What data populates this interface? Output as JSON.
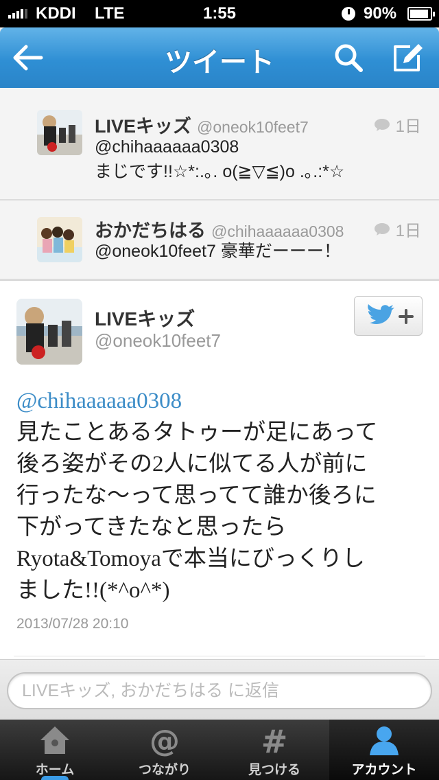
{
  "status_bar": {
    "carrier": "KDDI",
    "network": "LTE",
    "time": "1:55",
    "battery": "90%"
  },
  "nav": {
    "title": "ツイート"
  },
  "replies": [
    {
      "name": "LIVEキッズ",
      "handle": "@oneok10feet7",
      "age": "1日",
      "lines": [
        "@chihaaaaaa0308",
        "まじです!!☆*:.｡. o(≧▽≦)o .｡.:*☆"
      ]
    },
    {
      "name": "おかだちはる",
      "handle": "@chihaaaaaa0308",
      "age": "1日",
      "lines": [
        "@oneok10feet7 豪華だーーー！"
      ]
    }
  ],
  "tweet": {
    "name": "LIVEキッズ",
    "handle": "@oneok10feet7",
    "mention": "@chihaaaaaa0308",
    "lines": [
      "見たことあるタトゥーが足にあって",
      "後ろ姿がその2人に似てる人が前に",
      "行ったな〜って思ってて誰か後ろに",
      "下がってきたなと思ったら",
      "Ryota&Tomoyaで本当にびっくりし",
      "ました!!(*^o^*)"
    ],
    "timestamp": "2013/07/28 20:10"
  },
  "reply_box": {
    "placeholder": "LIVEキッズ, おかだちはる に返信"
  },
  "tabs": [
    {
      "label": "ホーム",
      "icon": "home-icon"
    },
    {
      "label": "つながり",
      "icon": "at-icon"
    },
    {
      "label": "見つける",
      "icon": "hash-icon"
    },
    {
      "label": "アカウント",
      "icon": "person-icon",
      "active": true
    }
  ],
  "colors": {
    "nav_blue": "#2f8fd4",
    "mention_blue": "#3b8cc7",
    "tab_active_glow": "#3a9be6"
  }
}
